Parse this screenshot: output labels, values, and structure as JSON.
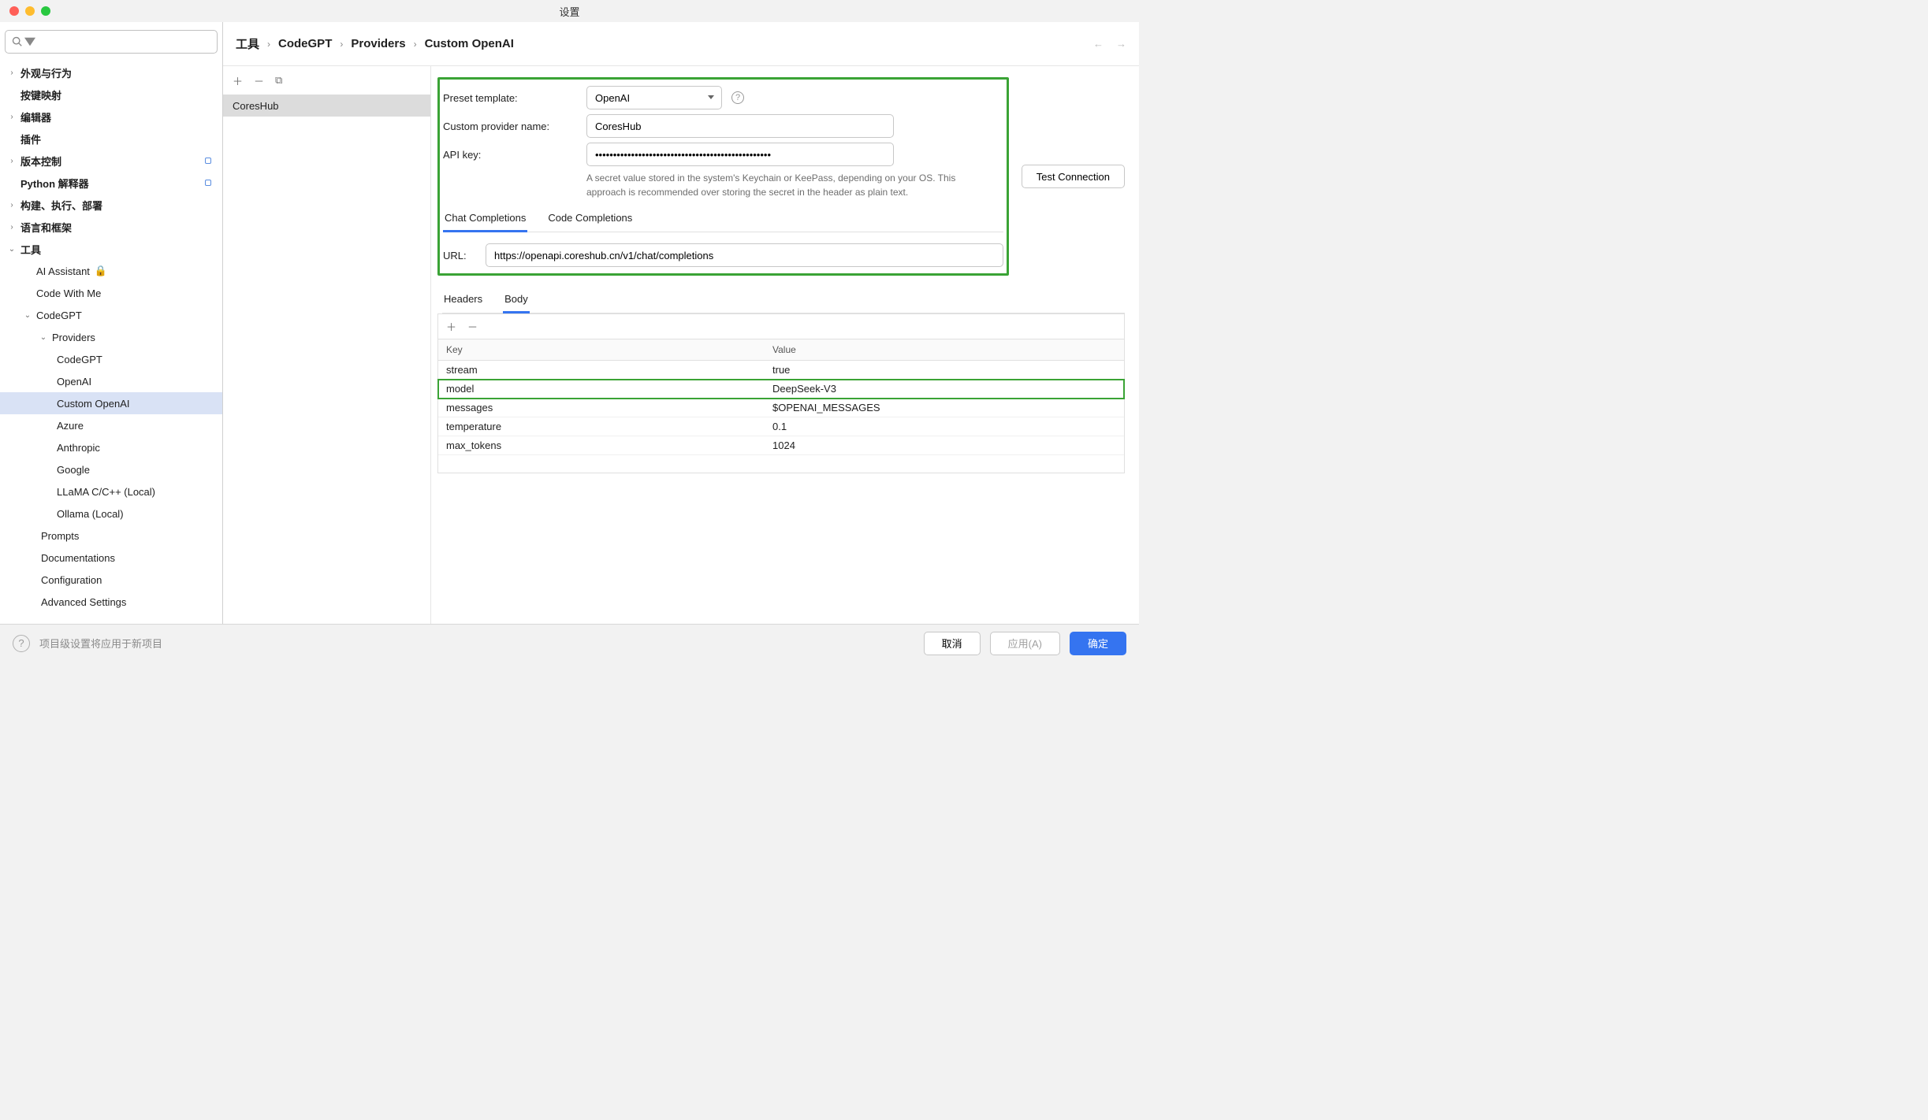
{
  "titlebar": {
    "title": "设置"
  },
  "search": {
    "placeholder": ""
  },
  "sidebar": {
    "items": [
      {
        "label": "外观与行为"
      },
      {
        "label": "按键映射"
      },
      {
        "label": "编辑器"
      },
      {
        "label": "插件"
      },
      {
        "label": "版本控制"
      },
      {
        "label": "Python 解释器"
      },
      {
        "label": "构建、执行、部署"
      },
      {
        "label": "语言和框架"
      },
      {
        "label": "工具"
      },
      {
        "label": "AI Assistant"
      },
      {
        "label": "Code With Me"
      },
      {
        "label": "CodeGPT"
      },
      {
        "label": "Providers"
      },
      {
        "label": "CodeGPT"
      },
      {
        "label": "OpenAI"
      },
      {
        "label": "Custom OpenAI"
      },
      {
        "label": "Azure"
      },
      {
        "label": "Anthropic"
      },
      {
        "label": "Google"
      },
      {
        "label": "LLaMA C/C++ (Local)"
      },
      {
        "label": "Ollama (Local)"
      },
      {
        "label": "Prompts"
      },
      {
        "label": "Documentations"
      },
      {
        "label": "Configuration"
      },
      {
        "label": "Advanced Settings"
      }
    ]
  },
  "breadcrumb": {
    "seg0": "工具",
    "seg1": "CodeGPT",
    "seg2": "Providers",
    "seg3": "Custom OpenAI"
  },
  "providerList": {
    "item0": "CoresHub"
  },
  "form": {
    "presetTemplateLabel": "Preset template:",
    "presetTemplateValue": "OpenAI",
    "customProviderLabel": "Custom provider name:",
    "customProviderValue": "CoresHub",
    "apiKeyLabel": "API key:",
    "apiKeyValue": "•••••••••••••••••••••••••••••••••••••••••••••••••",
    "apiKeyHint": "A secret value stored in the system's Keychain or KeePass, depending on your OS. This approach is recommended over storing the secret in the header as plain text.",
    "tabChat": "Chat Completions",
    "tabCode": "Code Completions",
    "urlLabel": "URL:",
    "urlValue": "https://openapi.coreshub.cn/v1/chat/completions",
    "testConnection": "Test Connection",
    "subTabHeaders": "Headers",
    "subTabBody": "Body"
  },
  "kv": {
    "headKey": "Key",
    "headValue": "Value",
    "rows": [
      {
        "k": "stream",
        "v": "true"
      },
      {
        "k": "model",
        "v": "DeepSeek-V3"
      },
      {
        "k": "messages",
        "v": "$OPENAI_MESSAGES"
      },
      {
        "k": "temperature",
        "v": "0.1"
      },
      {
        "k": "max_tokens",
        "v": "1024"
      }
    ]
  },
  "footer": {
    "msg": "项目级设置将应用于新项目",
    "cancel": "取消",
    "apply": "应用(A)",
    "ok": "确定"
  }
}
